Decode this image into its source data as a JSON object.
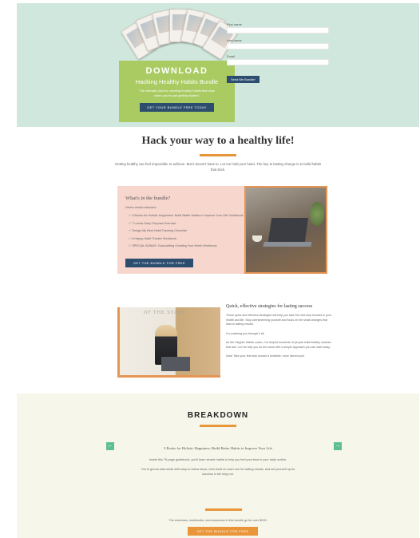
{
  "hero": {
    "download_title": "DOWNLOAD",
    "download_subtitle": "Hacking Healthy Habits Bundle",
    "download_desc": "The ultimate plan for creating healthy habits that stick when you're just getting started.",
    "download_button": "GET YOUR BUNDLE FREE TODAY",
    "form": {
      "first_name_label": "First name",
      "last_name_label": "Last name",
      "email_label": "Email",
      "submit_label": "Send Me Bundle!"
    }
  },
  "intro": {
    "heading": "Hack your way to a healthy life!",
    "text": "Getting healthy can feel impossible to achieve. But it doesn't have to. Let me hold your hand. The key to lasting change is to build habits that stick."
  },
  "included": {
    "heading": "What's in the bundle?",
    "intro": "Here's what's included:",
    "items": [
      "3 Books for Holistic Happiness: Build Better Habits to Improve Your Life Guidebook",
      "7 Levels Deep Purpose Exercise",
      "Design My Best Habit Tracking Checklist",
      "A Happy Habit Tracker Workbook",
      "SPECIAL BONUS: Goal-setting Creating Your Worth Workbook"
    ],
    "button": "GET THE BUNDLE FOR FREE"
  },
  "success": {
    "photo_sign": "OF THE STARS",
    "heading": "Quick, effective strategies for lasting success",
    "paragraphs": [
      "These quick and effective strategies will help you take the next step forward in your health and life. Stop overwhelming yourself and focus on the small changes that lead to lasting results.",
      "I'm coaching you through it all.",
      "As the Happier Habits coach, I've helped hundreds of people build healthy routines that last. Let me help you do the same with a simple approach you can start today.",
      "Now! Take your first step toward a healthier, more vibrant you!"
    ]
  },
  "breakdown": {
    "heading": "BREAKDOWN",
    "arrow_left": "←",
    "arrow_right": "→",
    "item_title": "3 Books for Holistic Happiness: Build Better Habits to Improve Your Life",
    "item_paragraphs": [
      "Inside this 75-page guidebook, you'll learn simple habits to help you feel your best in your daily routine.",
      "You're gonna start small with easy-to-follow steps, then build on each one for lasting results, and set yourself up for success in the long run."
    ],
    "footer_text": "The exercises, workbooks, and resources in this bundle go for over $200.",
    "button": "GET THE BUNDLE FOR FREE"
  },
  "colors": {
    "hero_bg": "#cfe7dc",
    "download_bg": "#a9cb62",
    "button_navy": "#2c4d6e",
    "accent_orange": "#e9953a",
    "pink_panel": "#f6d6cd",
    "breakdown_bg": "#f7f6ea",
    "arrow_green": "#5fbf94"
  }
}
